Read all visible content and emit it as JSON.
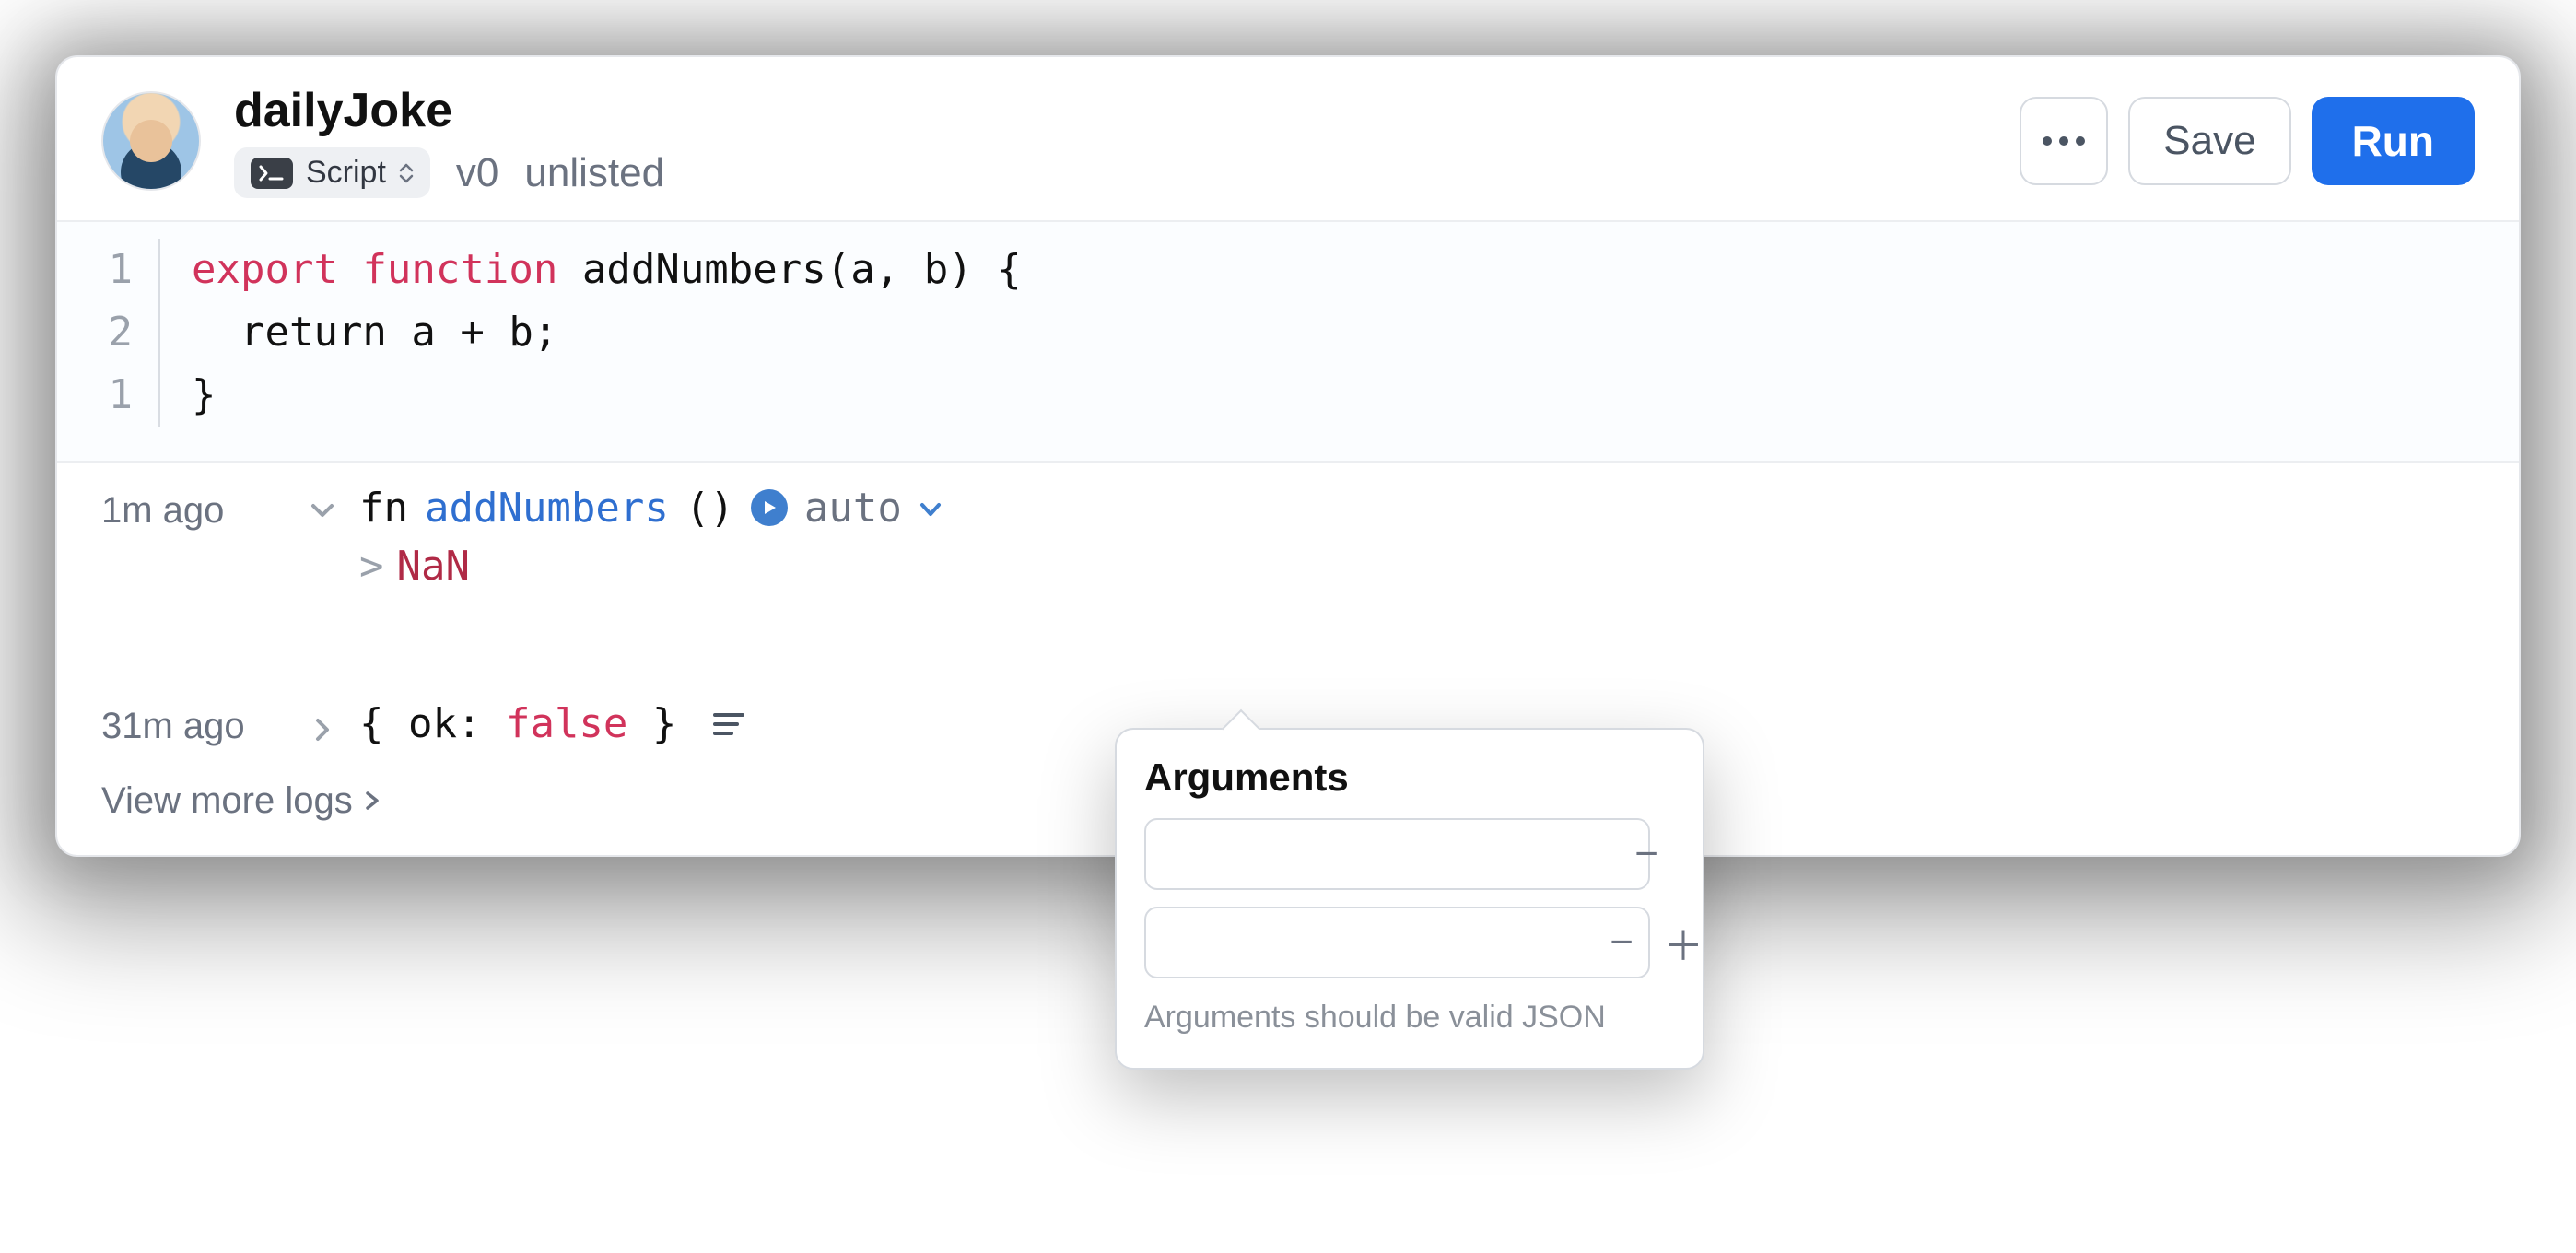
{
  "header": {
    "title": "dailyJoke",
    "script_chip_label": "Script",
    "version": "v0",
    "visibility": "unlisted",
    "save_label": "Save",
    "run_label": "Run"
  },
  "editor": {
    "lines": [
      {
        "n": "1",
        "tokens": [
          {
            "t": "export ",
            "c": "kw-export"
          },
          {
            "t": "function ",
            "c": "kw-function"
          },
          {
            "t": "addNumbers(a, b) {",
            "c": ""
          }
        ]
      },
      {
        "n": "2",
        "tokens": [
          {
            "t": "  ",
            "c": ""
          },
          {
            "t": "return",
            "c": "kw-return"
          },
          {
            "t": " a + b;",
            "c": ""
          }
        ]
      },
      {
        "n": "1",
        "tokens": [
          {
            "t": "}",
            "c": ""
          }
        ]
      }
    ]
  },
  "results": {
    "call": {
      "time": "1m ago",
      "fn_prefix": "fn ",
      "fn_name": "addNumbers",
      "fn_paren": "()",
      "mode": "auto",
      "output_prefix": ">",
      "output": "NaN"
    },
    "prev": {
      "time": "31m ago",
      "expr_open": "{ ",
      "expr_key": "ok:",
      "expr_val": " false",
      "expr_close": " }"
    },
    "view_more": "View more logs"
  },
  "popover": {
    "title": "Arguments",
    "help": "Arguments should be valid JSON",
    "args": [
      "",
      ""
    ]
  }
}
